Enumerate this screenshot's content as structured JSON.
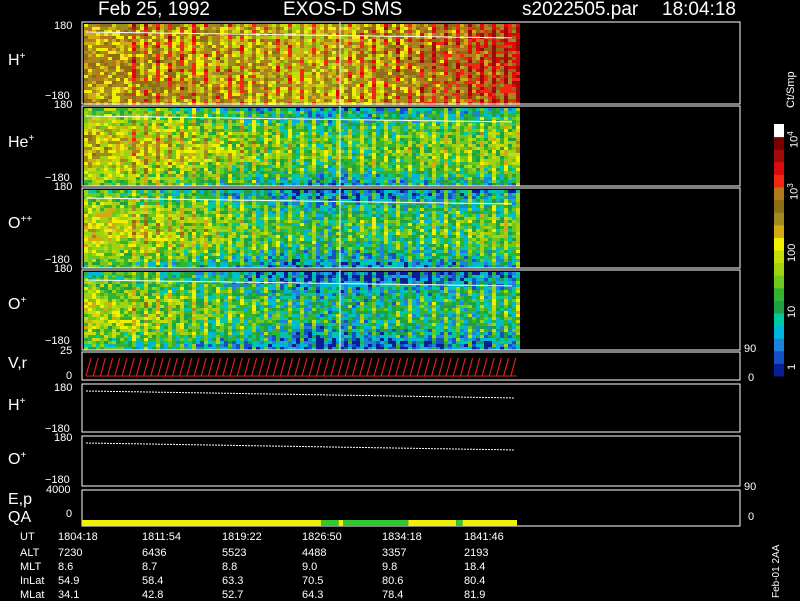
{
  "header": {
    "date": "Feb 25, 1992",
    "instrument": "EXOS-D SMS",
    "file": "s2022505.par",
    "time": "18:04:18"
  },
  "colorbar": {
    "unit": "Ct/Smp",
    "ticks": [
      "1",
      "10",
      "100",
      "10",
      "10"
    ],
    "tick_exps": [
      "",
      "",
      "",
      "3",
      "4"
    ],
    "colors": [
      "#0a1e96",
      "#1450c8",
      "#1e82dc",
      "#00b4dc",
      "#00c8a0",
      "#1ea046",
      "#32b432",
      "#6ec81e",
      "#a0d214",
      "#c8dc0a",
      "#f0f000",
      "#d2aa14",
      "#a08c1e",
      "#8c6e14",
      "#b4781e",
      "#f02814",
      "#dc0a0a",
      "#a00a0a",
      "#780000",
      "#ffffff"
    ]
  },
  "footer_note": "Feb-01 2AA",
  "chart_data": {
    "type": "heatmap",
    "time_start": "1804:18",
    "time_end": "1841:46",
    "panels": [
      {
        "id": "H+",
        "label": "H",
        "sup": "+",
        "ytop": "180",
        "ybot": "−180"
      },
      {
        "id": "He+",
        "label": "He",
        "sup": "+",
        "ytop": "180",
        "ybot": "−180"
      },
      {
        "id": "O++",
        "label": "O",
        "sup": "++",
        "ytop": "180",
        "ybot": "−180"
      },
      {
        "id": "O+",
        "label": "O",
        "sup": "+",
        "ytop": "180",
        "ybot": "−180"
      }
    ],
    "vr_panel": {
      "label": "V,r",
      "ytop": "25",
      "ybot": "0",
      "right_top": "90",
      "right_bot": "0"
    },
    "line_panels": [
      {
        "label": "H",
        "sup": "+",
        "ytop": "180",
        "ybot": "−180"
      },
      {
        "label": "O",
        "sup": "+",
        "ytop": "180",
        "ybot": "−180"
      }
    ],
    "ep_panel": {
      "label": "E,p",
      "ytop": "4000",
      "ybot": "0",
      "right_top": "90"
    },
    "qa_panel": {
      "label": "QA",
      "right_bot": "0",
      "segments": [
        {
          "start": 0.0,
          "end": 0.55,
          "color": "#f0f000"
        },
        {
          "start": 0.55,
          "end": 0.59,
          "color": "#32c832"
        },
        {
          "start": 0.59,
          "end": 0.6,
          "color": "#f0f000"
        },
        {
          "start": 0.6,
          "end": 0.75,
          "color": "#32c832"
        },
        {
          "start": 0.75,
          "end": 0.86,
          "color": "#f0f000"
        },
        {
          "start": 0.86,
          "end": 0.875,
          "color": "#32c832"
        },
        {
          "start": 0.875,
          "end": 1.0,
          "color": "#f0f000"
        }
      ]
    },
    "table": {
      "row_labels": [
        "UT",
        "ALT",
        "MLT",
        "InLat",
        "MLat"
      ],
      "columns": [
        [
          "1804:18",
          "7230",
          "8.6",
          "54.9",
          "34.1"
        ],
        [
          "1811:54",
          "6436",
          "8.7",
          "58.4",
          "42.8"
        ],
        [
          "1819:22",
          "5523",
          "8.8",
          "63.3",
          "52.7"
        ],
        [
          "1826:50",
          "4488",
          "9.0",
          "70.5",
          "64.3"
        ],
        [
          "1834:18",
          "3357",
          "9.8",
          "80.6",
          "78.4"
        ],
        [
          "1841:46",
          "2193",
          "18.4",
          "80.4",
          "81.9"
        ]
      ]
    }
  }
}
